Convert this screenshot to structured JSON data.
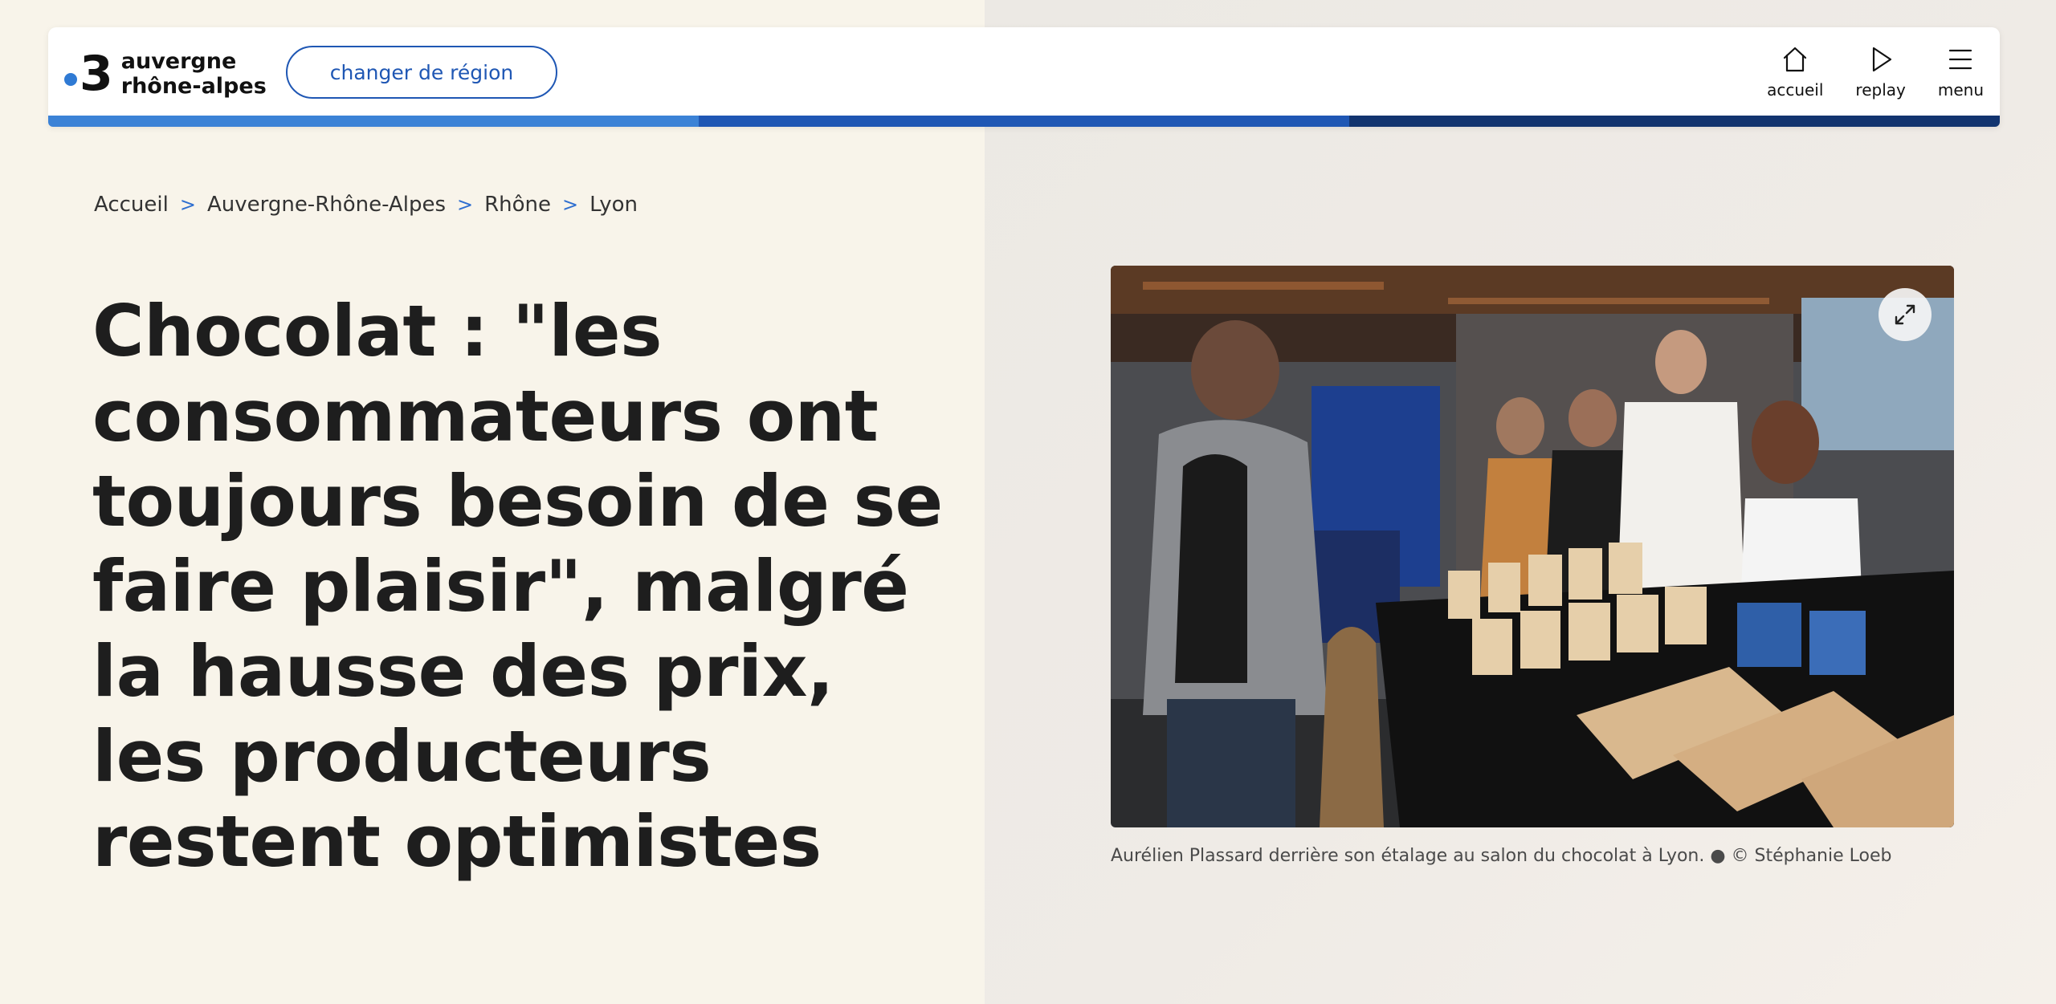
{
  "header": {
    "logo_number": "3",
    "logo_line1": "auvergne",
    "logo_line2": "rhône-alpes",
    "change_region_label": "changer de région",
    "nav": [
      {
        "label": "accueil",
        "icon": "home-icon"
      },
      {
        "label": "replay",
        "icon": "play-icon"
      },
      {
        "label": "menu",
        "icon": "hamburger-menu-icon"
      }
    ],
    "bar_colors": [
      "#3b82d6",
      "#1f57b4",
      "#12346f"
    ]
  },
  "breadcrumb": {
    "items": [
      "Accueil",
      "Auvergne-Rhône-Alpes",
      "Rhône",
      "Lyon"
    ],
    "separator": ">"
  },
  "article": {
    "title": "Chocolat : \"les consommateurs ont toujours besoin de se faire plaisir\", malgré la hausse des prix, les producteurs restent optimistes",
    "caption": "Aurélien Plassard derrière son étalage au salon du chocolat à Lyon. ● © Stéphanie Loeb"
  },
  "colors": {
    "accent": "#1f57b4",
    "background_left": "#f8f4ea",
    "background_right": "#ece9e4"
  }
}
